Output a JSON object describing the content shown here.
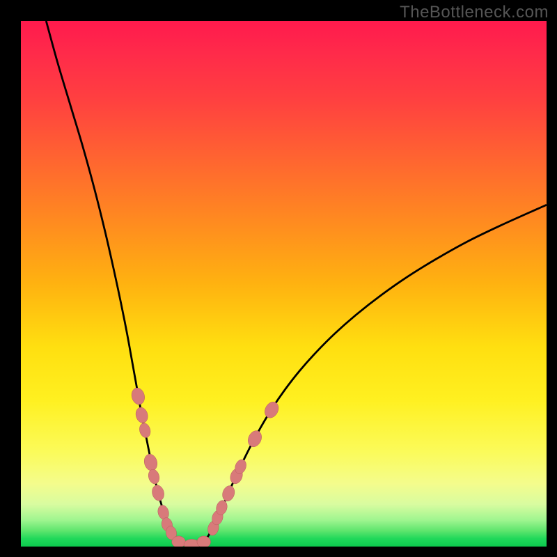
{
  "watermark": "TheBottleneck.com",
  "chart_data": {
    "type": "line",
    "title": "",
    "xlabel": "",
    "ylabel": "",
    "x_range": [
      0,
      100
    ],
    "y_range": [
      0,
      100
    ],
    "curves": [
      {
        "name": "left-branch",
        "points": [
          [
            4.8,
            100
          ],
          [
            7.0,
            92.0
          ],
          [
            9.4,
            84.0
          ],
          [
            11.8,
            76.0
          ],
          [
            14.0,
            68.0
          ],
          [
            16.0,
            60.0
          ],
          [
            17.6,
            53.0
          ],
          [
            19.0,
            46.5
          ],
          [
            20.2,
            40.5
          ],
          [
            21.2,
            35.0
          ],
          [
            22.1,
            30.0
          ],
          [
            22.9,
            25.5
          ],
          [
            23.7,
            21.5
          ],
          [
            24.4,
            18.0
          ],
          [
            25.1,
            14.5
          ],
          [
            25.8,
            11.5
          ],
          [
            26.5,
            8.8
          ],
          [
            27.2,
            6.5
          ],
          [
            27.9,
            4.5
          ],
          [
            28.6,
            3.0
          ],
          [
            29.3,
            1.8
          ],
          [
            30.3,
            0.7
          ],
          [
            31.4,
            0.15
          ]
        ]
      },
      {
        "name": "right-branch",
        "points": [
          [
            33.6,
            0.15
          ],
          [
            34.6,
            0.7
          ],
          [
            35.5,
            1.8
          ],
          [
            36.3,
            3.2
          ],
          [
            37.2,
            5.0
          ],
          [
            38.2,
            7.2
          ],
          [
            39.3,
            9.8
          ],
          [
            40.6,
            12.7
          ],
          [
            42.1,
            15.9
          ],
          [
            43.8,
            19.3
          ],
          [
            45.7,
            22.8
          ],
          [
            47.8,
            26.3
          ],
          [
            50.2,
            29.8
          ],
          [
            53.0,
            33.4
          ],
          [
            56.2,
            37.0
          ],
          [
            59.8,
            40.6
          ],
          [
            63.9,
            44.2
          ],
          [
            68.5,
            47.8
          ],
          [
            73.5,
            51.3
          ],
          [
            79.0,
            54.7
          ],
          [
            84.9,
            58.0
          ],
          [
            91.3,
            61.1
          ],
          [
            100.0,
            65.0
          ]
        ]
      }
    ],
    "markers": [
      {
        "cx": 22.3,
        "cy": 28.6,
        "rx": 1.2,
        "ry": 1.6,
        "rot": -15
      },
      {
        "cx": 23.0,
        "cy": 25.0,
        "rx": 1.1,
        "ry": 1.5,
        "rot": -15
      },
      {
        "cx": 23.6,
        "cy": 22.1,
        "rx": 1.0,
        "ry": 1.4,
        "rot": -15
      },
      {
        "cx": 24.7,
        "cy": 16.0,
        "rx": 1.2,
        "ry": 1.6,
        "rot": -15
      },
      {
        "cx": 25.3,
        "cy": 13.3,
        "rx": 1.0,
        "ry": 1.4,
        "rot": -15
      },
      {
        "cx": 26.1,
        "cy": 10.2,
        "rx": 1.1,
        "ry": 1.5,
        "rot": -15
      },
      {
        "cx": 27.1,
        "cy": 6.5,
        "rx": 1.0,
        "ry": 1.4,
        "rot": -15
      },
      {
        "cx": 27.8,
        "cy": 4.2,
        "rx": 1.0,
        "ry": 1.3,
        "rot": -15
      },
      {
        "cx": 28.6,
        "cy": 2.6,
        "rx": 1.0,
        "ry": 1.3,
        "rot": -10
      },
      {
        "cx": 30.0,
        "cy": 0.9,
        "rx": 1.3,
        "ry": 1.1,
        "rot": 0
      },
      {
        "cx": 32.5,
        "cy": 0.4,
        "rx": 1.5,
        "ry": 1.0,
        "rot": 0
      },
      {
        "cx": 34.8,
        "cy": 0.9,
        "rx": 1.3,
        "ry": 1.1,
        "rot": 0
      },
      {
        "cx": 36.6,
        "cy": 3.5,
        "rx": 1.0,
        "ry": 1.4,
        "rot": 15
      },
      {
        "cx": 37.4,
        "cy": 5.5,
        "rx": 1.0,
        "ry": 1.4,
        "rot": 15
      },
      {
        "cx": 38.2,
        "cy": 7.4,
        "rx": 1.0,
        "ry": 1.4,
        "rot": 15
      },
      {
        "cx": 39.5,
        "cy": 10.1,
        "rx": 1.1,
        "ry": 1.5,
        "rot": 18
      },
      {
        "cx": 41.0,
        "cy": 13.4,
        "rx": 1.1,
        "ry": 1.5,
        "rot": 20
      },
      {
        "cx": 41.8,
        "cy": 15.2,
        "rx": 1.0,
        "ry": 1.4,
        "rot": 20
      },
      {
        "cx": 44.5,
        "cy": 20.5,
        "rx": 1.2,
        "ry": 1.6,
        "rot": 25
      },
      {
        "cx": 47.7,
        "cy": 26.0,
        "rx": 1.2,
        "ry": 1.6,
        "rot": 28
      }
    ],
    "background_gradient": {
      "type": "vertical",
      "stops": [
        {
          "pos": 0.0,
          "color": "#ff1a4d"
        },
        {
          "pos": 0.5,
          "color": "#ffb210"
        },
        {
          "pos": 0.82,
          "color": "#fbfb5a"
        },
        {
          "pos": 1.0,
          "color": "#0cc94e"
        }
      ]
    }
  }
}
